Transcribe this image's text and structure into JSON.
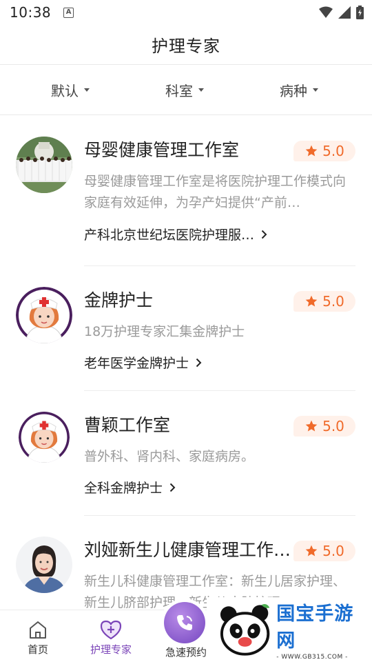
{
  "status_bar": {
    "time": "10:38",
    "a_icon": "A"
  },
  "header": {
    "title": "护理专家"
  },
  "filters": [
    {
      "label": "默认"
    },
    {
      "label": "科室"
    },
    {
      "label": "病种"
    }
  ],
  "experts": [
    {
      "name": "母婴健康管理工作室",
      "rating": "5.0",
      "description": "母婴健康管理工作室是将医院护理工作模式向家庭有效延伸，为孕产妇提供“产前…",
      "tag": "产科北京世纪坛医院护理服…",
      "avatar": "group-photo"
    },
    {
      "name": "金牌护士",
      "rating": "5.0",
      "description": "18万护理专家汇集金牌护士",
      "tag": "老年医学金牌护士",
      "avatar": "nurse-cartoon"
    },
    {
      "name": "曹颖工作室",
      "rating": "5.0",
      "description": "普外科、肾内科、家庭病房。",
      "tag": "全科金牌护士",
      "avatar": "nurse-cartoon"
    },
    {
      "name": "刘娅新生儿健康管理工作…",
      "rating": "5.0",
      "description": "新生儿科健康管理工作室：新生儿居家护理、新生儿脐部护理、新生儿皮肤护理",
      "tag": "",
      "avatar": "woman-portrait"
    }
  ],
  "tabbar": {
    "tabs": [
      {
        "label": "首页",
        "icon": "home-icon"
      },
      {
        "label": "护理专家",
        "icon": "heart-plus-icon"
      },
      {
        "label": "急速预约",
        "icon": "phone-icon"
      }
    ],
    "active_index": 1
  },
  "watermark": {
    "title": "国宝手游网",
    "url": "- WWW.GB315.COM -"
  },
  "colors": {
    "accent": "#7b45b8",
    "rating": "#f06a2a",
    "rating_bg": "#fff1ea"
  }
}
